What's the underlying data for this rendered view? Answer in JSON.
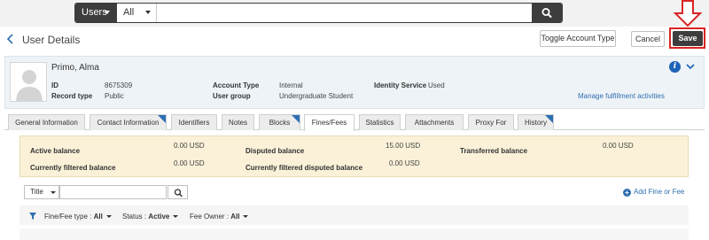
{
  "search": {
    "scope_label": "Users",
    "filter_label": "All",
    "query": ""
  },
  "header": {
    "title": "User Details",
    "toggle_label": "Toggle Account Type",
    "cancel_label": "Cancel",
    "save_label": "Save"
  },
  "user": {
    "name": "Primo, Alma",
    "id_label": "ID",
    "id_value": "8675309",
    "record_type_label": "Record type",
    "record_type_value": "Public",
    "account_type_label": "Account Type",
    "account_type_value": "Internal",
    "user_group_label": "User group",
    "user_group_value": "Undergraduate Student",
    "identity_service_label": "Identity Service",
    "identity_service_value": "Used",
    "manage_link": "Manage fulfillment activities"
  },
  "tabs": [
    {
      "label": "General Information",
      "corner": false
    },
    {
      "label": "Contact Information",
      "corner": true
    },
    {
      "label": "Identifiers",
      "corner": false
    },
    {
      "label": "Notes",
      "corner": false
    },
    {
      "label": "Blocks",
      "corner": true
    },
    {
      "label": "Fines/Fees",
      "corner": false,
      "active": true
    },
    {
      "label": "Statistics",
      "corner": false
    },
    {
      "label": "Attachments",
      "corner": false
    },
    {
      "label": "Proxy For",
      "corner": false
    },
    {
      "label": "History",
      "corner": true
    }
  ],
  "balances": {
    "active_label": "Active balance",
    "active_value": "0.00 USD",
    "filtered_label": "Currently filtered balance",
    "filtered_value": "0.00 USD",
    "disputed_label": "Disputed balance",
    "disputed_value": "15.00 USD",
    "filtered_disputed_label": "Currently filtered disputed balance",
    "filtered_disputed_value": "0.00 USD",
    "transferred_label": "Transferred balance",
    "transferred_value": "0.00 USD"
  },
  "filter": {
    "field_label": "Title",
    "query": "",
    "add_label": "Add Fine or Fee"
  },
  "facets": [
    {
      "label": "Fine/Fee type :",
      "value": "All"
    },
    {
      "label": "Status :",
      "value": "Active"
    },
    {
      "label": "Fee Owner :",
      "value": "All"
    }
  ],
  "colors": {
    "accent": "#2f6fb0",
    "dark_button": "#3d3d3d",
    "highlight_red": "#d92424",
    "balance_bg": "#faf1d8"
  }
}
